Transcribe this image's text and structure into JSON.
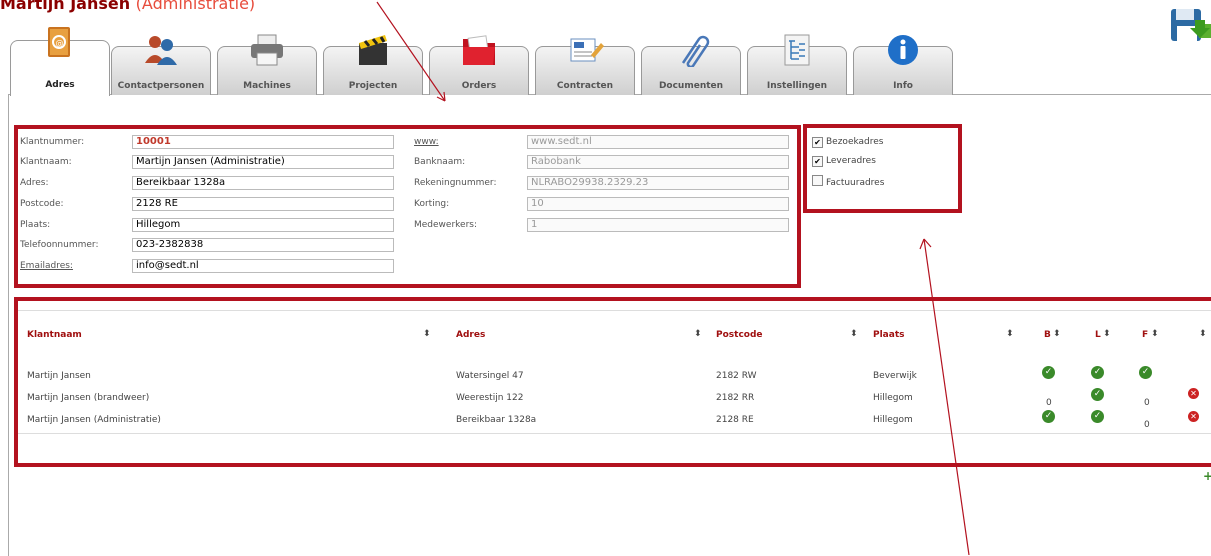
{
  "header": {
    "title_left": "Martijn Jansen",
    "title_paren": "(Administratie)"
  },
  "tabs": [
    {
      "label": "Adres",
      "icon": "address-book-icon"
    },
    {
      "label": "Contactpersonen",
      "icon": "contacts-icon"
    },
    {
      "label": "Machines",
      "icon": "printer-icon"
    },
    {
      "label": "Projecten",
      "icon": "clapperboard-icon"
    },
    {
      "label": "Orders",
      "icon": "folder-icon"
    },
    {
      "label": "Contracten",
      "icon": "contract-icon"
    },
    {
      "label": "Documenten",
      "icon": "paperclip-icon"
    },
    {
      "label": "Instellingen",
      "icon": "settings-tree-icon"
    },
    {
      "label": "Info",
      "icon": "info-icon"
    }
  ],
  "form": {
    "left": [
      {
        "label": "Klantnummer:",
        "value": "10001"
      },
      {
        "label": "Klantnaam:",
        "value": "Martijn Jansen (Administratie)"
      },
      {
        "label": "Adres:",
        "value": "Bereikbaar 1328a"
      },
      {
        "label": "Postcode:",
        "value": "2128 RE"
      },
      {
        "label": "Plaats:",
        "value": "Hillegom"
      },
      {
        "label": "Telefoonnummer:",
        "value": "023-2382838"
      },
      {
        "label": "Emailadres:",
        "value": "info@sedt.nl"
      }
    ],
    "right": [
      {
        "label": "www:",
        "value": "www.sedt.nl"
      },
      {
        "label": "Banknaam:",
        "value": "Rabobank"
      },
      {
        "label": "Rekeningnummer:",
        "value": "NLRABO29938.2329.23"
      },
      {
        "label": "Korting:",
        "value": "10"
      },
      {
        "label": "Medewerkers:",
        "value": "1"
      }
    ]
  },
  "address_types": [
    {
      "label": "Bezoekadres",
      "checked": true
    },
    {
      "label": "Leveradres",
      "checked": true
    },
    {
      "label": "Factuuradres",
      "checked": false
    }
  ],
  "table": {
    "headers": [
      "Klantnaam",
      "Adres",
      "Postcode",
      "Plaats",
      "B",
      "L",
      "F"
    ],
    "rows": [
      {
        "klantnaam": "Martijn Jansen",
        "adres": "Watersingel 47",
        "postcode": "2182 RW",
        "plaats": "Beverwijk",
        "b": "ok",
        "l": "ok",
        "f": "ok",
        "delete": false
      },
      {
        "klantnaam": "Martijn Jansen (brandweer)",
        "adres": "Weerestijn 122",
        "postcode": "2182 RR",
        "plaats": "Hillegom",
        "b": "0",
        "l": "ok",
        "f": "0",
        "delete": true
      },
      {
        "klantnaam": "Martijn Jansen (Administratie)",
        "adres": "Bereikbaar 1328a",
        "postcode": "2128 RE",
        "plaats": "Hillegom",
        "b": "ok",
        "l": "ok",
        "f": "0",
        "delete": true
      }
    ]
  },
  "colors": {
    "highlight": "#b3121f",
    "header_text": "#a01010",
    "check_green": "#3a8a2a"
  }
}
